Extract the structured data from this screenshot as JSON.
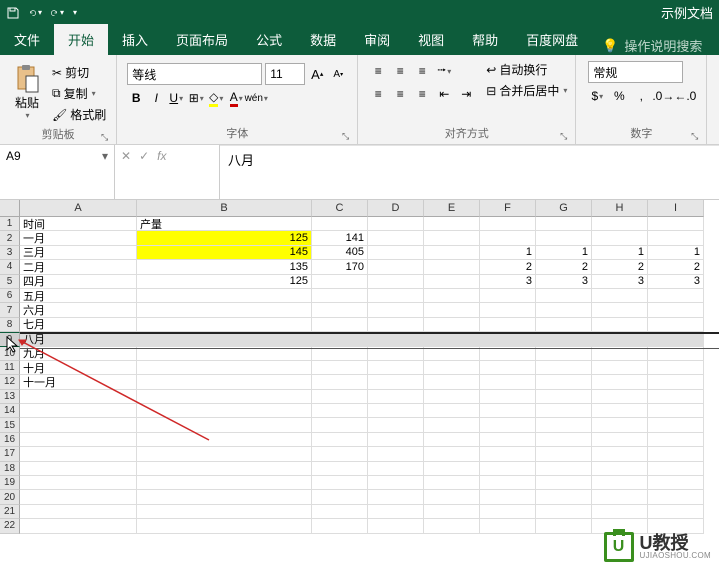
{
  "title_right": "示例文档",
  "tabs": [
    "文件",
    "开始",
    "插入",
    "页面布局",
    "公式",
    "数据",
    "审阅",
    "视图",
    "帮助",
    "百度网盘"
  ],
  "tell_me": "操作说明搜索",
  "clipboard": {
    "paste": "粘贴",
    "cut": "剪切",
    "copy": "复制",
    "format": "格式刷",
    "label": "剪贴板"
  },
  "font": {
    "name": "等线",
    "size": "11",
    "label": "字体"
  },
  "alignment": {
    "wrap": "自动换行",
    "merge": "合并后居中",
    "label": "对齐方式"
  },
  "number": {
    "format": "常规",
    "label": "数字"
  },
  "name_box": "A9",
  "formula": "八月",
  "col_headers": [
    "A",
    "B",
    "C",
    "D",
    "E",
    "F",
    "G",
    "H",
    "I"
  ],
  "row_count": 22,
  "cells": {
    "A1": "时间",
    "B1": "产量",
    "A2": "一月",
    "B2": "125",
    "C2": "141",
    "A3": "三月",
    "B3": "145",
    "C3": "405",
    "F3": "1",
    "G3": "1",
    "H3": "1",
    "I3": "1",
    "A4": "二月",
    "B4": "135",
    "C4": "170",
    "F4": "2",
    "G4": "2",
    "H4": "2",
    "I4": "2",
    "A5": "四月",
    "B5": "125",
    "F5": "3",
    "G5": "3",
    "H5": "3",
    "I5": "3",
    "A6": "五月",
    "A7": "六月",
    "A8": "七月",
    "A9": "八月",
    "A10": "九月",
    "A11": "十月",
    "A12": "十一月"
  },
  "watermark": {
    "logo": "U",
    "name": "U教授",
    "url": "UJIAOSHOU.COM"
  },
  "chart_data": {
    "type": "table",
    "title": "",
    "columns": [
      "时间",
      "产量",
      "",
      "",
      "",
      "",
      "",
      "",
      ""
    ],
    "rows": [
      [
        "一月",
        125,
        141,
        null,
        null,
        null,
        null,
        null,
        null
      ],
      [
        "三月",
        145,
        405,
        null,
        null,
        1,
        1,
        1,
        1
      ],
      [
        "二月",
        135,
        170,
        null,
        null,
        2,
        2,
        2,
        2
      ],
      [
        "四月",
        125,
        null,
        null,
        null,
        3,
        3,
        3,
        3
      ],
      [
        "五月",
        null,
        null,
        null,
        null,
        null,
        null,
        null,
        null
      ],
      [
        "六月",
        null,
        null,
        null,
        null,
        null,
        null,
        null,
        null
      ],
      [
        "七月",
        null,
        null,
        null,
        null,
        null,
        null,
        null,
        null
      ],
      [
        "八月",
        null,
        null,
        null,
        null,
        null,
        null,
        null,
        null
      ],
      [
        "九月",
        null,
        null,
        null,
        null,
        null,
        null,
        null,
        null
      ],
      [
        "十月",
        null,
        null,
        null,
        null,
        null,
        null,
        null,
        null
      ],
      [
        "十一月",
        null,
        null,
        null,
        null,
        null,
        null,
        null,
        null
      ]
    ]
  }
}
